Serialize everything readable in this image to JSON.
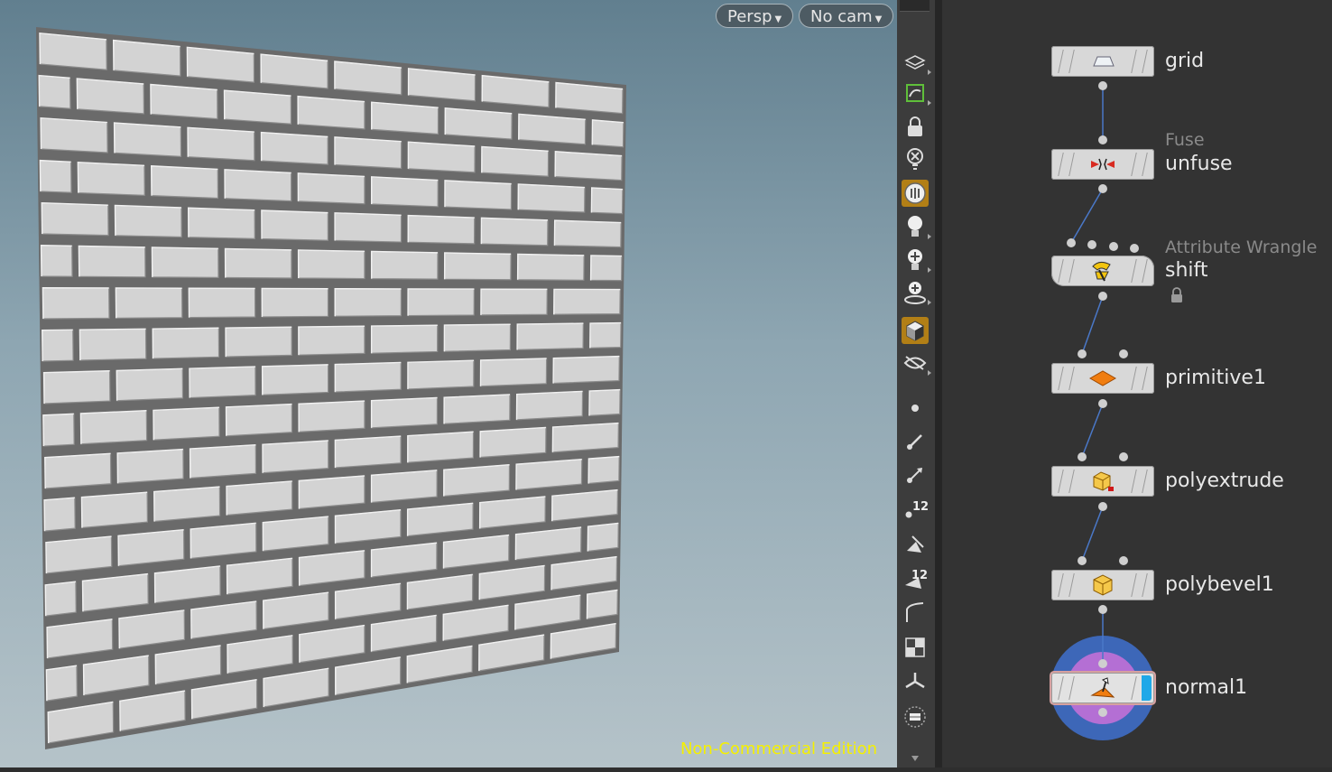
{
  "viewport": {
    "persp_label": "Persp",
    "cam_label": "No cam",
    "watermark": "Non-Commercial Edition",
    "background_top": "#617f8f",
    "background_bottom": "#b5c3c9",
    "brick_color": "#d3d3d3"
  },
  "toolbar": {
    "icons": [
      "layers-icon",
      "select-icon",
      "lock-icon",
      "ghost-icon",
      "display-icon",
      "light-icon",
      "headlight-icon",
      "light-manager-icon",
      "shading-icon",
      "visibility-icon",
      "point-icon",
      "normals-icon",
      "vector-icon",
      "point-numbers-icon",
      "clip-icon",
      "prim-numbers-icon",
      "curve-icon",
      "checker-icon",
      "origin-icon",
      "menu-icon",
      "scroll-down-icon"
    ],
    "point_number_badge": "12",
    "prim_number_badge": "12"
  },
  "network": {
    "nodes": [
      {
        "name": "grid",
        "type": ""
      },
      {
        "name": "unfuse",
        "type": "Fuse"
      },
      {
        "name": "shift",
        "type": "Attribute Wrangle"
      },
      {
        "name": "primitive1",
        "type": ""
      },
      {
        "name": "polyextrude",
        "type": ""
      },
      {
        "name": "polybevel1",
        "type": ""
      },
      {
        "name": "normal1",
        "type": ""
      }
    ],
    "display_flag_color": "#1fa8e8",
    "selection_ring_color": "#3d67b8"
  }
}
